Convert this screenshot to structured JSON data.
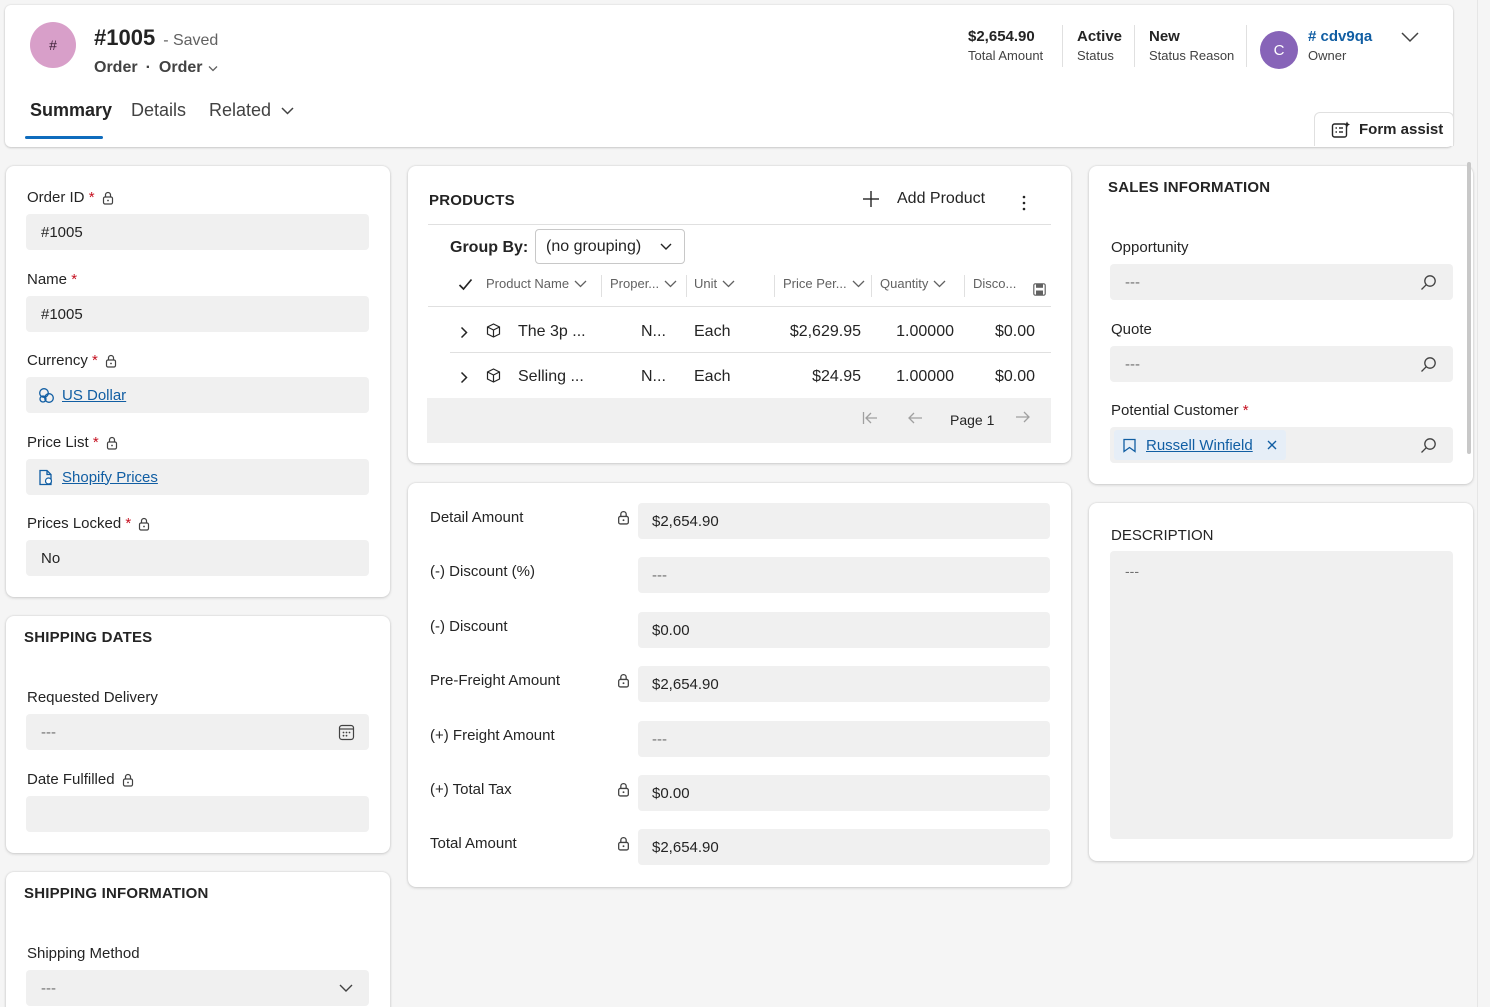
{
  "header": {
    "avatar_initial": "#",
    "avatar_color": "#d89fc9",
    "title": "#1005",
    "saved": "- Saved",
    "entity": "Order",
    "form_selector": "Order",
    "stats": [
      {
        "value": "$2,654.90",
        "label": "Total Amount"
      },
      {
        "value": "Active",
        "label": "Status"
      },
      {
        "value": "New",
        "label": "Status Reason"
      }
    ],
    "owner": {
      "initial": "C",
      "color": "#8764b8",
      "name": "# cdv9qa",
      "label": "Owner"
    }
  },
  "tabs": [
    {
      "label": "Summary",
      "active": true
    },
    {
      "label": "Details",
      "active": false
    },
    {
      "label": "Related",
      "active": false
    }
  ],
  "form_assist_label": "Form assist",
  "general": {
    "order_id_label": "Order ID",
    "order_id_value": "#1005",
    "name_label": "Name",
    "name_value": "#1005",
    "currency_label": "Currency",
    "currency_value": "US Dollar",
    "price_list_label": "Price List",
    "price_list_value": "Shopify Prices",
    "prices_locked_label": "Prices Locked",
    "prices_locked_value": "No"
  },
  "shipping_dates": {
    "title": "SHIPPING DATES",
    "requested_delivery_label": "Requested Delivery",
    "requested_delivery_value": "---",
    "date_fulfilled_label": "Date Fulfilled",
    "date_fulfilled_value": ""
  },
  "shipping_info": {
    "title": "SHIPPING INFORMATION",
    "shipping_method_label": "Shipping Method",
    "shipping_method_value": "---"
  },
  "products": {
    "title": "PRODUCTS",
    "add_label": "Add Product",
    "group_by_label": "Group By:",
    "group_by_value": "(no grouping)",
    "columns": [
      "Product Name",
      "Proper...",
      "Unit",
      "Price Per...",
      "Quantity",
      "Disco..."
    ],
    "rows": [
      {
        "name": "The 3p ...",
        "property": "N...",
        "unit": "Each",
        "price": "$2,629.95",
        "quantity": "1.00000",
        "discount": "$0.00"
      },
      {
        "name": "Selling ...",
        "property": "N...",
        "unit": "Each",
        "price": "$24.95",
        "quantity": "1.00000",
        "discount": "$0.00"
      }
    ],
    "page_label": "Page 1"
  },
  "amounts": [
    {
      "label": "Detail Amount",
      "value": "$2,654.90",
      "locked": true
    },
    {
      "label": "(-) Discount (%)",
      "value": "---",
      "locked": false
    },
    {
      "label": "(-) Discount",
      "value": "$0.00",
      "locked": false
    },
    {
      "label": "Pre-Freight Amount",
      "value": "$2,654.90",
      "locked": true
    },
    {
      "label": "(+) Freight Amount",
      "value": "---",
      "locked": false
    },
    {
      "label": "(+) Total Tax",
      "value": "$0.00",
      "locked": true
    },
    {
      "label": "Total Amount",
      "value": "$2,654.90",
      "locked": true
    }
  ],
  "sales_info": {
    "title": "SALES INFORMATION",
    "opportunity_label": "Opportunity",
    "opportunity_value": "---",
    "quote_label": "Quote",
    "quote_value": "---",
    "potential_customer_label": "Potential Customer",
    "potential_customer_value": "Russell Winfield"
  },
  "description": {
    "title": "DESCRIPTION",
    "value": "---"
  },
  "required_mark": "*"
}
